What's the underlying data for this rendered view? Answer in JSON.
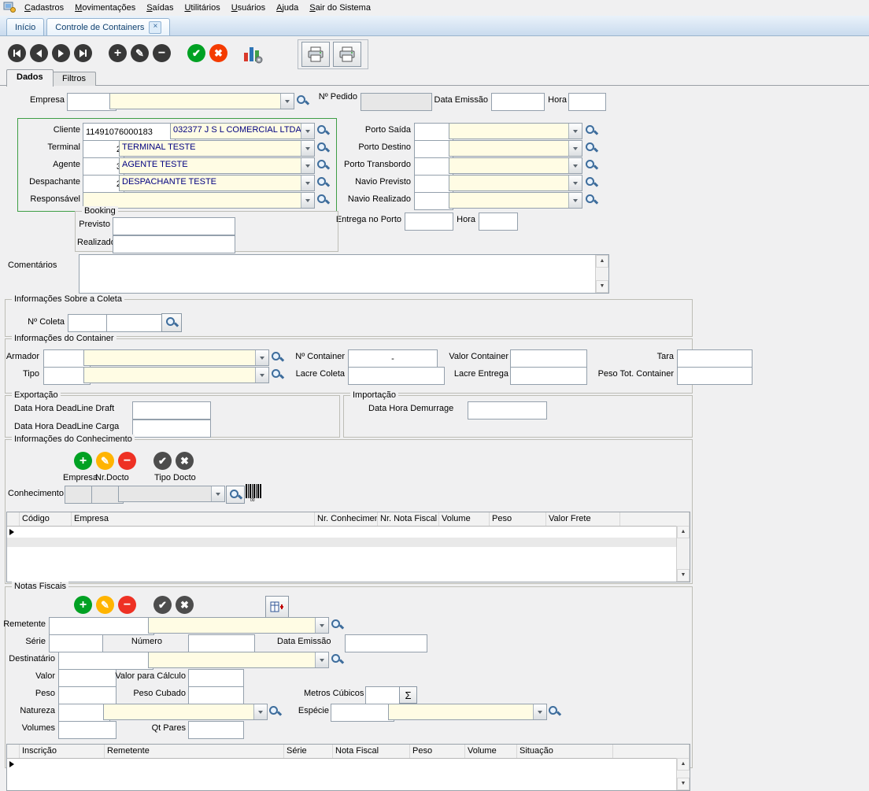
{
  "menubar": {
    "items": [
      "Cadastros",
      "Movimentações",
      "Saídas",
      "Utilitários",
      "Usuários",
      "Ajuda",
      "Sair do Sistema"
    ]
  },
  "window_tabs": {
    "inicio": "Início",
    "active": "Controle de Containers"
  },
  "page_tabs": {
    "dados": "Dados",
    "filtros": "Filtros"
  },
  "icons": {
    "add": "+",
    "edit": "✎",
    "remove": "−",
    "confirm": "✔",
    "cancel": "✖",
    "close": "×",
    "sigma": "Σ",
    "up": "▲",
    "down": "▼"
  },
  "header": {
    "empresa_label": "Empresa",
    "pedido_label": "Nº Pedido",
    "data_emissao_label": "Data Emissão",
    "hora_label": "Hora"
  },
  "cliente": {
    "cliente_label": "Cliente",
    "cliente_code": "11491076000183",
    "cliente_name": "032377  J S L COMERCIAL LTDA",
    "terminal_label": "Terminal",
    "terminal_code": "2",
    "terminal_name": "TERMINAL TESTE",
    "agente_label": "Agente",
    "agente_code": "3",
    "agente_name": "AGENTE TESTE",
    "despachante_label": "Despachante",
    "despachante_code": "2",
    "despachante_name": "DESPACHANTE TESTE",
    "responsavel_label": "Responsável"
  },
  "portos": {
    "porto_saida_label": "Porto Saída",
    "porto_destino_label": "Porto Destino",
    "porto_transbordo_label": "Porto Transbordo",
    "navio_previsto_label": "Navio Previsto",
    "navio_realizado_label": "Navio Realizado",
    "entrega_label": "Entrega no Porto",
    "hora_label": "Hora"
  },
  "booking": {
    "title": "Booking",
    "previsto_label": "Previsto",
    "realizado_label": "Realizado"
  },
  "comentarios": {
    "label": "Comentários"
  },
  "coleta": {
    "title": "Informações Sobre a Coleta",
    "n_coleta_label": "Nº Coleta"
  },
  "container": {
    "title": "Informações do Container",
    "armador_label": "Armador",
    "tipo_label": "Tipo",
    "n_container_label": "Nº Container",
    "n_container_value": "-",
    "lacre_coleta_label": "Lacre Coleta",
    "valor_container_label": "Valor Container",
    "lacre_entrega_label": "Lacre Entrega",
    "tara_label": "Tara",
    "peso_tot_label": "Peso Tot. Container"
  },
  "exportacao": {
    "title": "Exportação",
    "draft_label": "Data Hora DeadLine Draft",
    "carga_label": "Data Hora DeadLine Carga"
  },
  "importacao": {
    "title": "Importação",
    "demurrage_label": "Data Hora Demurrage"
  },
  "conhecimento": {
    "title": "Informações do Conhecimento",
    "empresa_label": "Empresa",
    "nr_docto_label": "Nr.Docto",
    "tipo_docto_label": "Tipo Docto",
    "conhecimento_label": "Conhecimento",
    "headers": [
      "Código",
      "Empresa",
      "Nr. Conhecimento",
      "Nr. Nota Fiscal",
      "Volume",
      "Peso",
      "Valor Frete"
    ]
  },
  "notas": {
    "title": "Notas Fiscais",
    "remetente_label": "Remetente",
    "serie_label": "Série",
    "numero_label": "Número",
    "data_emissao_label": "Data Emissão",
    "destinatario_label": "Destinatário",
    "valor_label": "Valor",
    "valor_calculo_label": "Valor para Cálculo",
    "peso_label": "Peso",
    "peso_cubado_label": "Peso Cubado",
    "metros_cubicos_label": "Metros Cúbicos",
    "natureza_label": "Natureza",
    "especie_label": "Espécie",
    "volumes_label": "Volumes",
    "qt_pares_label": "Qt Pares",
    "headers": [
      "Inscrição",
      "Remetente",
      "Série",
      "Nota Fiscal",
      "Peso",
      "Volume",
      "Situação"
    ]
  }
}
